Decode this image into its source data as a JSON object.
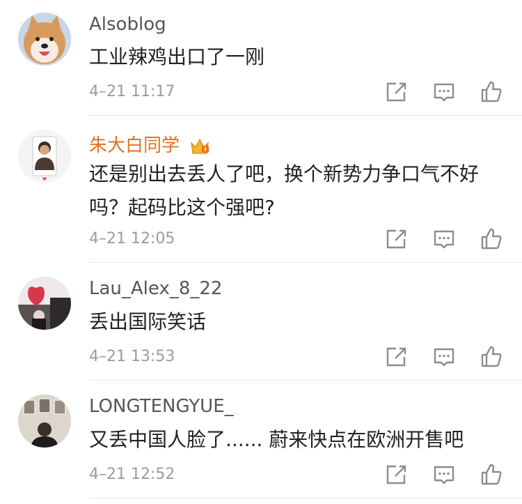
{
  "colors": {
    "vip_name": "#e3721d",
    "time": "#9b9b9b",
    "icon": "#8c8c8c"
  },
  "icons": {
    "forward": "forward-icon",
    "reply": "comment-icon",
    "like": "thumbs-up-icon",
    "crown": "vip-crown-icon"
  },
  "comments": [
    {
      "username": "Alsoblog",
      "text": "工业辣鸡出口了一刚",
      "time": "4–21 11:17"
    },
    {
      "username": "朱大白同学",
      "text": "还是别出去丢人了吧，换个新势力争口气不好吗？起码比这个强吧?",
      "time": "4–21 12:05"
    },
    {
      "username": "Lau_Alex_8_22",
      "text": "丢出国际笑话",
      "time": "4–21 13:53"
    },
    {
      "username": "LONGTENGYUE_",
      "text": "又丢中国人脸了...... 蔚来快点在欧洲开售吧",
      "time": "4–21 12:52"
    }
  ]
}
